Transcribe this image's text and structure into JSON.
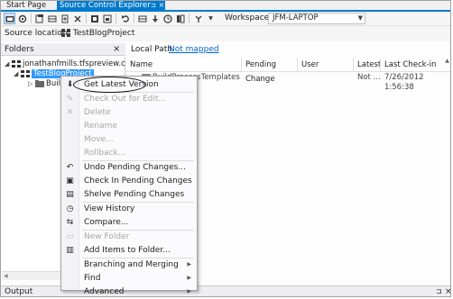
{
  "tabs": {
    "start_page": "Start Page",
    "source_control_explorer": "Source Control Explorer",
    "pin_glyph": "⊐",
    "close_glyph": "×"
  },
  "toolbar": {
    "workspace_label": "Workspace:",
    "workspace_value": "JFM-LAPTOP",
    "icons": [
      "new-folder-icon",
      "refresh-icon",
      "add-items-icon",
      "map-icon",
      "add-file-icon",
      "delete-icon",
      "undo-icon",
      "check-in-icon",
      "shelve-icon",
      "unshelve-icon",
      "history-icon",
      "compare-icon",
      "branch-icon"
    ]
  },
  "source_location": {
    "label": "Source location:",
    "value": "TestBlogProject"
  },
  "folders": {
    "title": "Folders",
    "close_glyph": "×",
    "root": "jonathanfmills.tfspreview.com\\D",
    "selected": "TestBlogProject",
    "child": "Build"
  },
  "local_path": {
    "label": "Local Path:",
    "link": "Not mapped"
  },
  "grid": {
    "columns": [
      "Name",
      "Pending Change",
      "User",
      "Latest",
      "Last Check-in"
    ],
    "row": {
      "name": "BuildProcessTemplates",
      "latest": "Not ...",
      "last_checkin": "7/26/2012 1:56:38"
    }
  },
  "context_menu": {
    "items": [
      {
        "label": "Get Latest Version",
        "icon": "get-latest-icon",
        "glyph": "⬇",
        "disabled": false
      },
      {
        "label": "Check Out for Edit...",
        "icon": "check-out-icon",
        "glyph": "✎",
        "disabled": true
      },
      {
        "label": "Delete",
        "icon": "delete-icon",
        "glyph": "✕",
        "disabled": true
      },
      {
        "label": "Rename",
        "icon": "",
        "glyph": "",
        "disabled": true
      },
      {
        "label": "Move...",
        "icon": "",
        "glyph": "",
        "disabled": true
      },
      {
        "label": "Rollback...",
        "icon": "",
        "glyph": "",
        "disabled": true
      },
      {
        "label": "Undo Pending Changes...",
        "icon": "undo-icon",
        "glyph": "↶",
        "disabled": false
      },
      {
        "label": "Check In Pending Changes",
        "icon": "check-in-icon",
        "glyph": "▣",
        "disabled": false
      },
      {
        "label": "Shelve Pending Changes",
        "icon": "shelve-icon",
        "glyph": "▤",
        "disabled": false
      },
      {
        "label": "View History",
        "icon": "history-icon",
        "glyph": "◷",
        "disabled": false
      },
      {
        "label": "Compare...",
        "icon": "compare-icon",
        "glyph": "⇆",
        "disabled": false
      },
      {
        "label": "New Folder",
        "icon": "new-folder-icon",
        "glyph": "▭",
        "disabled": true
      },
      {
        "label": "Add Items to Folder...",
        "icon": "add-items-icon",
        "glyph": "▥",
        "disabled": false
      },
      {
        "label": "Branching and Merging",
        "icon": "",
        "glyph": "",
        "disabled": false,
        "submenu": true
      },
      {
        "label": "Find",
        "icon": "",
        "glyph": "",
        "disabled": false,
        "submenu": true
      },
      {
        "label": "Advanced",
        "icon": "",
        "glyph": "",
        "disabled": false,
        "submenu": true
      }
    ],
    "submenu_glyph": "▶"
  },
  "output": {
    "title": "Output",
    "pin_glyph": "⊐",
    "close_glyph": "×"
  },
  "colors": {
    "accent": "#007acc",
    "link": "#0066cc",
    "selection": "#3399ff"
  }
}
